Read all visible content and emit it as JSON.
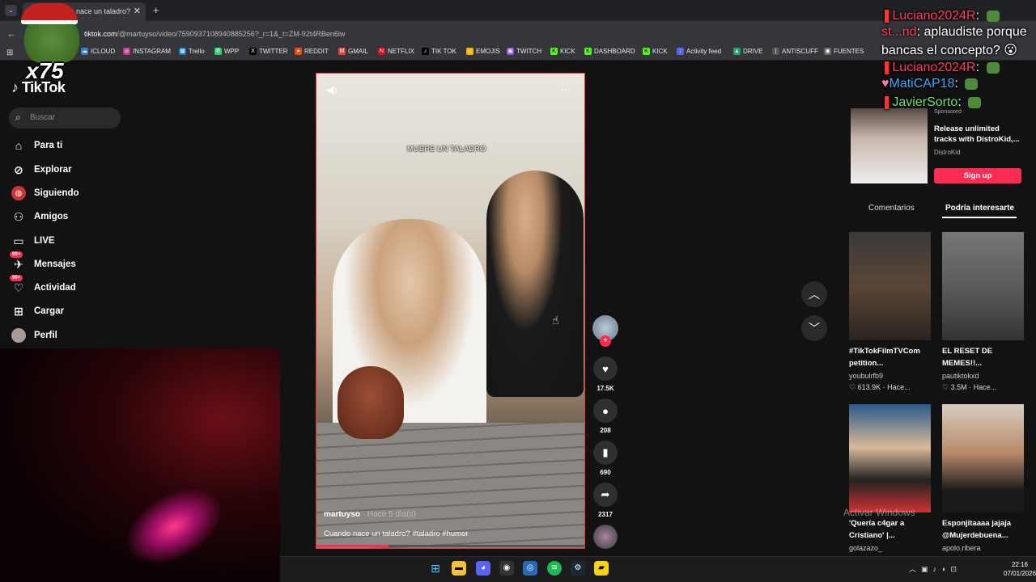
{
  "browser": {
    "tab_title": "nace un taladro?",
    "url_host": "tiktok.com",
    "url_path": "/@martuyso/video/7590937108940885256?_r=1&_t=ZM-92t4RBen6lw",
    "bookmarks": [
      "ICLOUD",
      "INSTAGRAM",
      "Trello",
      "WPP",
      "TWITTER",
      "REDDIT",
      "GMAIL",
      "NETFLIX",
      "TIK TOK",
      "EMOJIS",
      "TWITCH",
      "KICK",
      "DASHBOARD",
      "KICK",
      "Activity feed",
      "DRIVE",
      "ANTISCUFF",
      "FUENTES"
    ]
  },
  "overlay": {
    "emote_count": "x75",
    "chat": [
      {
        "user": "Luciano2024R",
        "text": ""
      },
      {
        "user": "st...nd",
        "text": "aplaudiste porque"
      },
      {
        "user": "",
        "text": "bancas el concepto?"
      },
      {
        "user": "Luciano2024R",
        "text": ""
      },
      {
        "user": "MatiCAP18",
        "text": ""
      },
      {
        "user": "JavierSorto",
        "text": ""
      }
    ]
  },
  "sidebar": {
    "logo": "TikTok",
    "search_placeholder": "Buscar",
    "items": [
      {
        "label": "Para ti"
      },
      {
        "label": "Explorar"
      },
      {
        "label": "Siguiendo"
      },
      {
        "label": "Amigos"
      },
      {
        "label": "LIVE"
      },
      {
        "label": "Mensajes",
        "badge": "99+"
      },
      {
        "label": "Actividad",
        "badge": "99+"
      },
      {
        "label": "Cargar"
      },
      {
        "label": "Perfil"
      }
    ]
  },
  "video": {
    "overlay_text": "MUERE UN TALADRO",
    "author": "martuyso",
    "time": " · Hace 5 día(s)",
    "caption": "Cuando nace un taladro? #taladro #humor",
    "progress": 0.27,
    "likes": "17.5K",
    "comments": "208",
    "saves": "690",
    "shares": "2317"
  },
  "ad": {
    "sponsored": "Sponsored",
    "title": "Release unlimited tracks with DistroKid,...",
    "brand": "DistroKid",
    "cta": "Sign up"
  },
  "right_tabs": {
    "comments": "Comentarios",
    "suggested": "Podría interesarte"
  },
  "suggested": [
    {
      "title": "#TikTokFilmTVCom petition...",
      "user": "youbulrfb9",
      "stats": "613.9K · Hace..."
    },
    {
      "title": "EL RESET DE MEMES!!...",
      "user": "pautiktokxd",
      "stats": "3.5M · Hace..."
    },
    {
      "title": "'Quería c4gar a Cristiano' |...",
      "user": "golazazo_",
      "stats": ""
    },
    {
      "title": "Esponjitaaaa jajaja @Mujerdebuena...",
      "user": "apolo.ribera",
      "stats": ""
    }
  ],
  "system": {
    "watermark": "Activar Windows",
    "time": "22:16",
    "date": "07/01/2026"
  },
  "colors": {
    "accent": "#fe2c55",
    "bg": "#121212"
  }
}
